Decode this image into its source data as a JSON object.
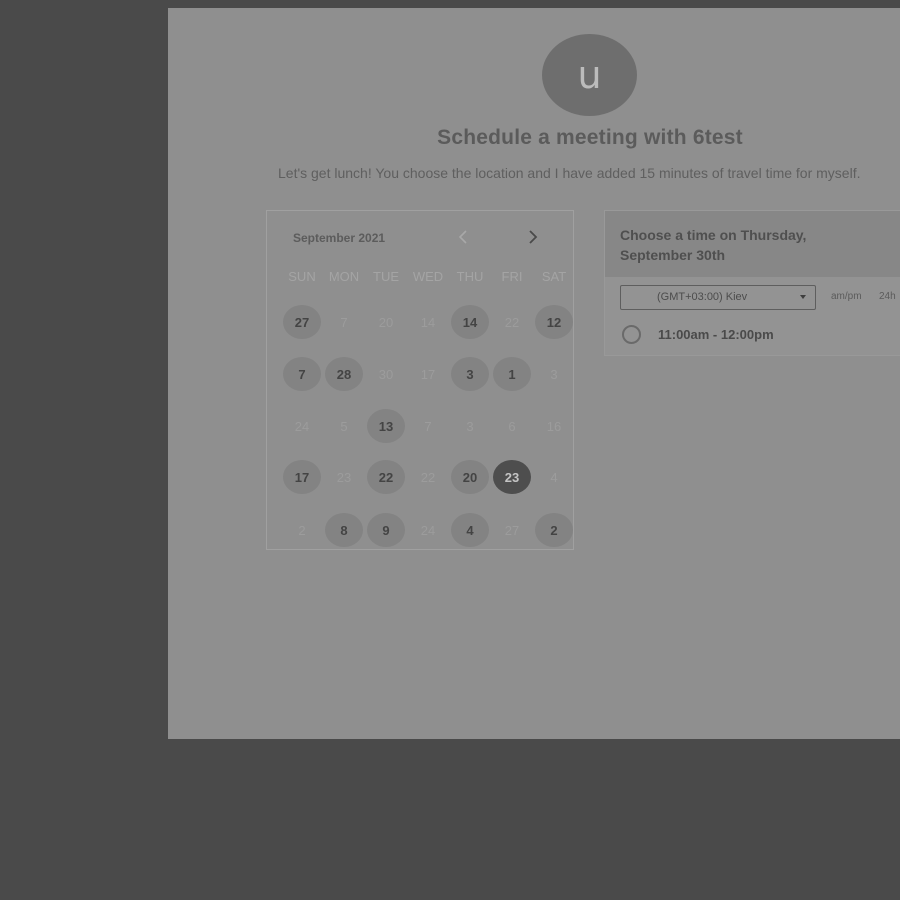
{
  "profile": {
    "avatar_initial": "u"
  },
  "header": {
    "title": "Schedule a meeting with 6test",
    "subtitle": "Let's get lunch! You choose the location and I have added 15 minutes of travel time for myself."
  },
  "calendar": {
    "month_label": "September 2021",
    "weekdays": [
      "SUN",
      "MON",
      "TUE",
      "WED",
      "THU",
      "FRI",
      "SAT"
    ],
    "weeks": [
      [
        {
          "d": "27",
          "s": "a"
        },
        {
          "d": "7",
          "s": "n"
        },
        {
          "d": "20",
          "s": "n"
        },
        {
          "d": "14",
          "s": "n"
        },
        {
          "d": "14",
          "s": "a"
        },
        {
          "d": "22",
          "s": "n"
        },
        {
          "d": "12",
          "s": "a"
        }
      ],
      [
        {
          "d": "7",
          "s": "a"
        },
        {
          "d": "28",
          "s": "a"
        },
        {
          "d": "30",
          "s": "n"
        },
        {
          "d": "17",
          "s": "n"
        },
        {
          "d": "3",
          "s": "a"
        },
        {
          "d": "1",
          "s": "a"
        },
        {
          "d": "3",
          "s": "n"
        }
      ],
      [
        {
          "d": "24",
          "s": "n"
        },
        {
          "d": "5",
          "s": "n"
        },
        {
          "d": "13",
          "s": "a"
        },
        {
          "d": "7",
          "s": "n"
        },
        {
          "d": "3",
          "s": "n"
        },
        {
          "d": "6",
          "s": "n"
        },
        {
          "d": "16",
          "s": "n"
        }
      ],
      [
        {
          "d": "17",
          "s": "a"
        },
        {
          "d": "23",
          "s": "n"
        },
        {
          "d": "22",
          "s": "a"
        },
        {
          "d": "22",
          "s": "n"
        },
        {
          "d": "20",
          "s": "a"
        },
        {
          "d": "23",
          "s": "s"
        },
        {
          "d": "4",
          "s": "n"
        }
      ],
      [
        {
          "d": "2",
          "s": "n"
        },
        {
          "d": "8",
          "s": "a"
        },
        {
          "d": "9",
          "s": "a"
        },
        {
          "d": "24",
          "s": "n"
        },
        {
          "d": "4",
          "s": "a"
        },
        {
          "d": "27",
          "s": "n"
        },
        {
          "d": "2",
          "s": "a"
        }
      ]
    ]
  },
  "time_panel": {
    "title": "Choose a time on Thursday, September 30th",
    "timezone": "(GMT+03:00) Kiev",
    "format_ampm": "am/pm",
    "format_24h": "24h",
    "slots": [
      {
        "label": "11:00am - 12:00pm"
      }
    ]
  }
}
